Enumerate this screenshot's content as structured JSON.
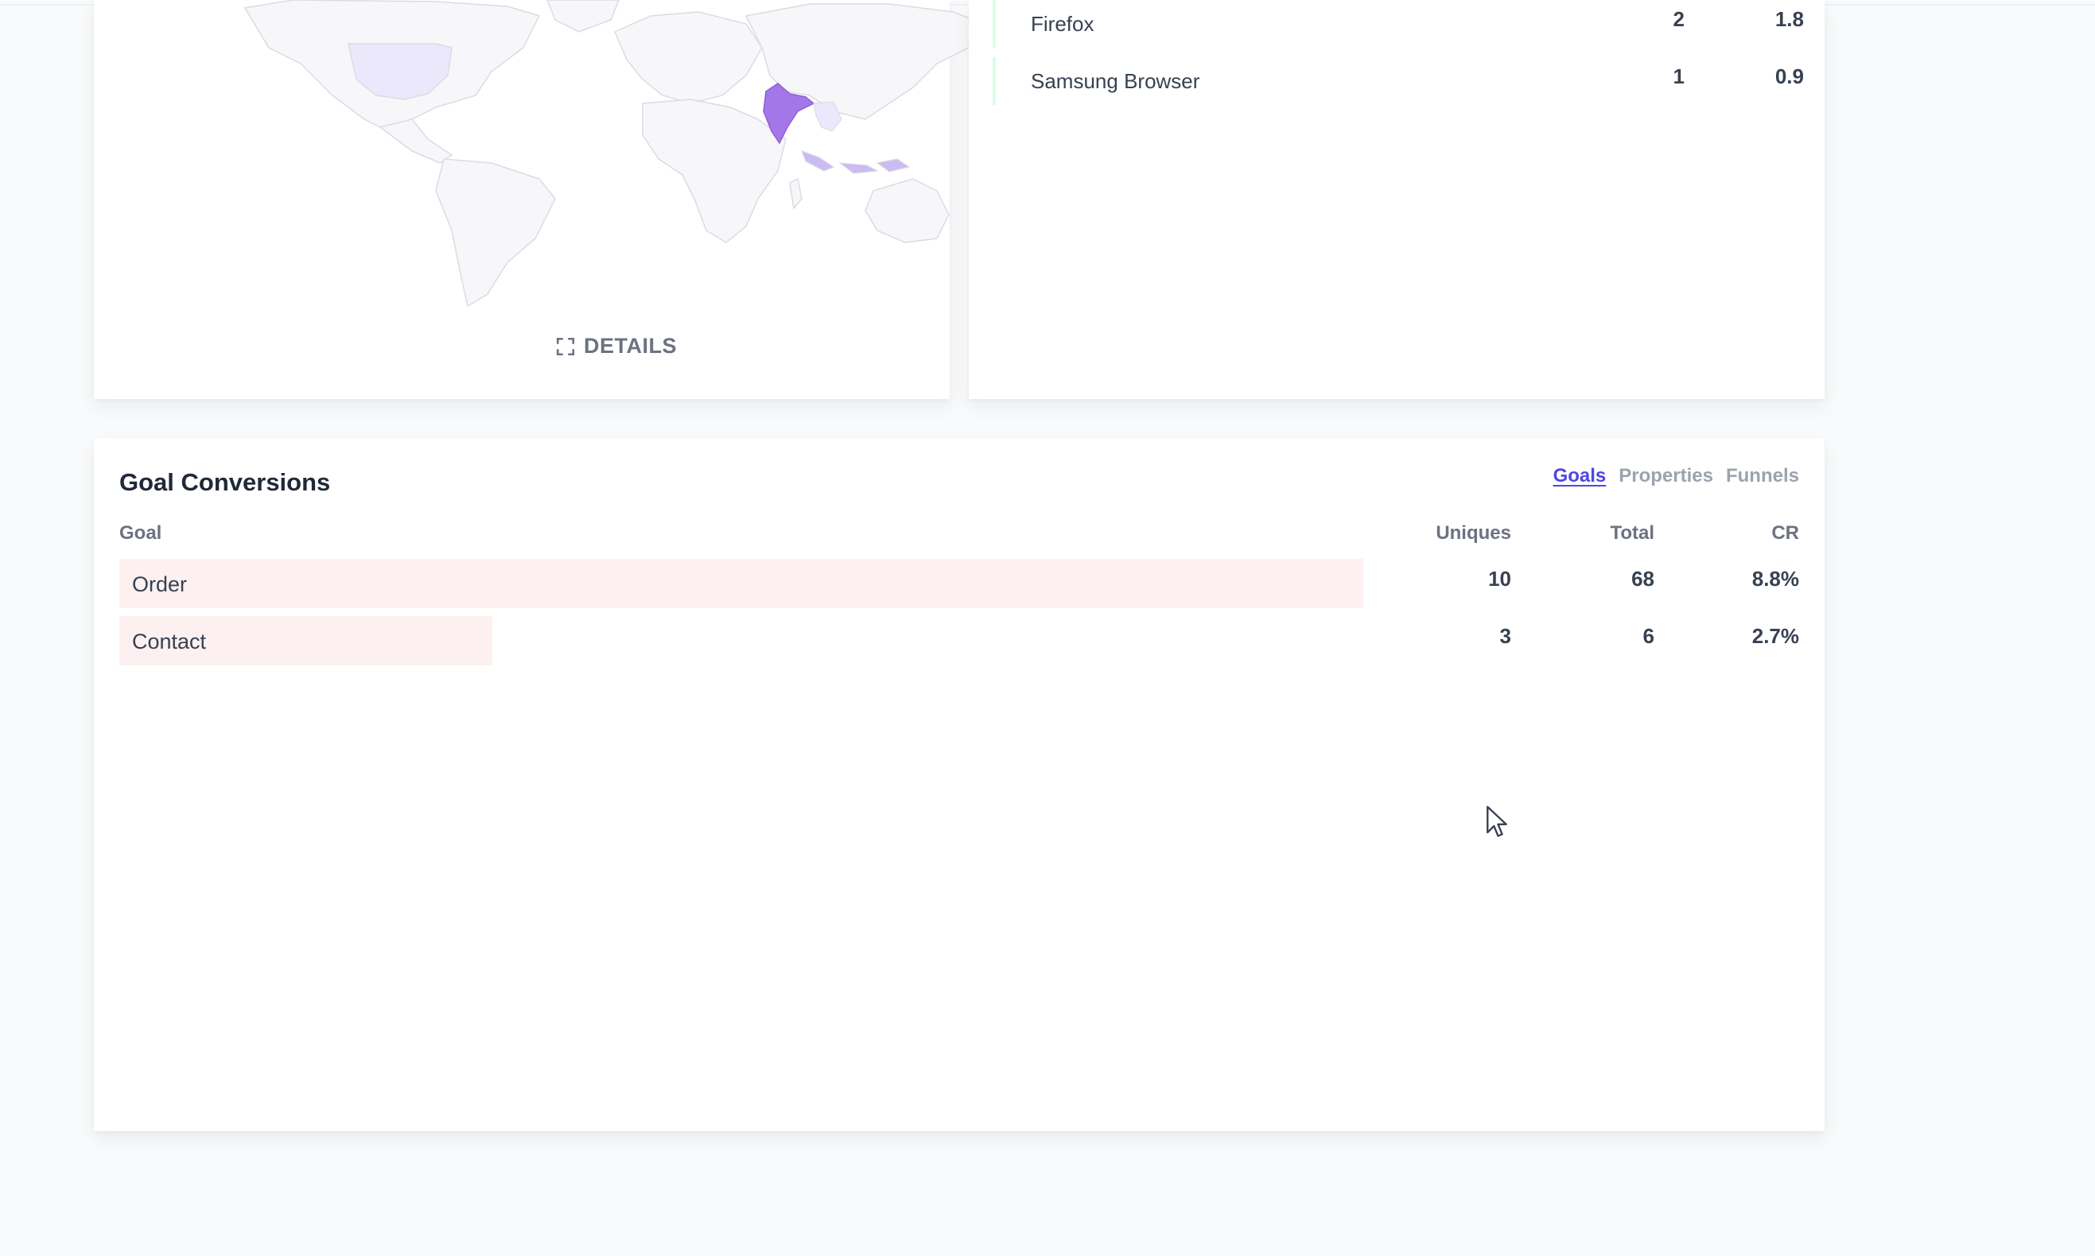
{
  "map_panel": {
    "details_label": "DETAILS",
    "highlight_colors": {
      "india": "#a477e8",
      "usa": "#ece8fb",
      "indonesia": "#cbbbf2",
      "base": "#f7f7fa"
    }
  },
  "browsers_panel": {
    "rows": [
      {
        "name": "Firefox",
        "visitors": "2",
        "percentage": "1.8"
      },
      {
        "name": "Samsung Browser",
        "visitors": "1",
        "percentage": "0.9"
      }
    ]
  },
  "goal_conversions": {
    "title": "Goal Conversions",
    "tabs": [
      {
        "label": "Goals",
        "active": true
      },
      {
        "label": "Properties",
        "active": false
      },
      {
        "label": "Funnels",
        "active": false
      }
    ],
    "columns": {
      "goal": "Goal",
      "uniques": "Uniques",
      "total": "Total",
      "cr": "CR"
    },
    "rows": [
      {
        "goal": "Order",
        "uniques": "10",
        "total": "68",
        "cr": "8.8%",
        "bar_fraction": 1.0
      },
      {
        "goal": "Contact",
        "uniques": "3",
        "total": "6",
        "cr": "2.7%",
        "bar_fraction": 0.3
      }
    ],
    "bar_color": "#fdf0f0",
    "accent_color": "#4f46e5"
  }
}
